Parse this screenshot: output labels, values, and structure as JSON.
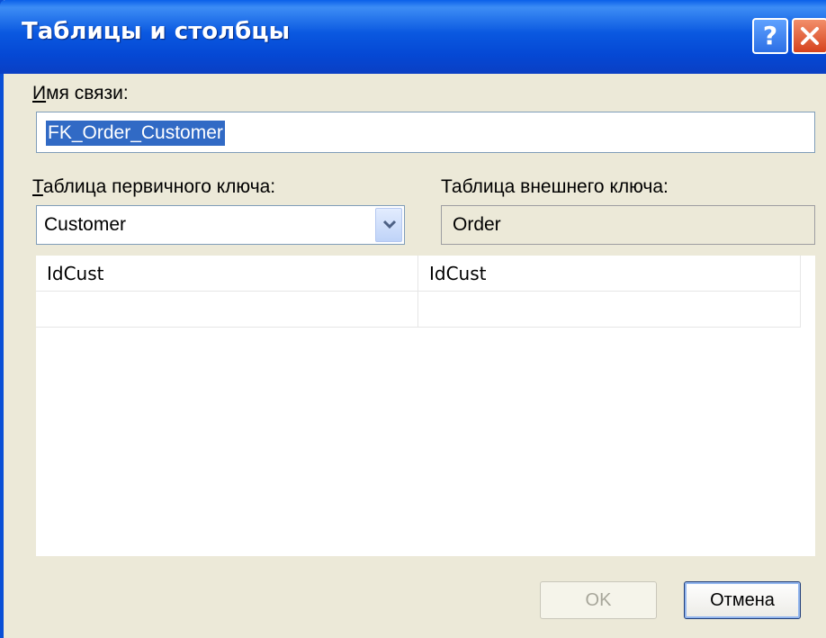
{
  "window": {
    "title": "Таблицы и столбцы",
    "help_label": "?"
  },
  "relationship": {
    "label_access_key": "И",
    "label_rest": "мя связи:",
    "value": "FK_Order_Customer"
  },
  "primary": {
    "label_access_key": "Т",
    "label_rest": "аблица первичного ключа:",
    "selected": "Customer"
  },
  "foreign": {
    "label": "Таблица внешнего ключа:",
    "value": "Order"
  },
  "columns": {
    "rows": [
      {
        "primary": "IdCust",
        "foreign": "IdCust"
      },
      {
        "primary": "",
        "foreign": ""
      }
    ]
  },
  "buttons": {
    "ok": "OK",
    "cancel": "Отмена"
  },
  "colors": {
    "titlebar": "#0A58E0",
    "dialog_bg": "#ECE9D8",
    "selection": "#316AC5",
    "close": "#D6431E"
  }
}
